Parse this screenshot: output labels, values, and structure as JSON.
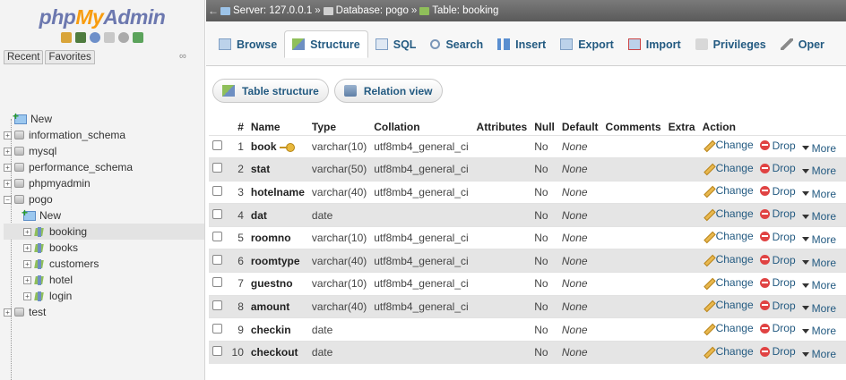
{
  "app": {
    "logo": {
      "php": "php",
      "my": "My",
      "admin": "Admin"
    }
  },
  "navigation": {
    "tabs": [
      "Recent",
      "Favorites"
    ],
    "new_label": "New",
    "databases": [
      "information_schema",
      "mysql",
      "performance_schema",
      "phpmyadmin",
      "pogo",
      "test"
    ],
    "pogo_children": [
      "New",
      "booking",
      "books",
      "customers",
      "hotel",
      "login"
    ],
    "selected_table": "booking"
  },
  "breadcrumb": {
    "server": "Server: 127.0.0.1",
    "database": "Database: pogo",
    "table": "Table: booking",
    "separator": "»"
  },
  "tabs": [
    "Browse",
    "Structure",
    "SQL",
    "Search",
    "Insert",
    "Export",
    "Import",
    "Privileges",
    "Oper"
  ],
  "active_tab": "Structure",
  "subtabs": [
    "Table structure",
    "Relation view"
  ],
  "table": {
    "headers": [
      "#",
      "Name",
      "Type",
      "Collation",
      "Attributes",
      "Null",
      "Default",
      "Comments",
      "Extra",
      "Action"
    ],
    "rows": [
      {
        "num": "1",
        "name": "book",
        "primary": true,
        "type": "varchar(10)",
        "collation": "utf8mb4_general_ci",
        "attributes": "",
        "null": "No",
        "default": "None",
        "comments": "",
        "extra": ""
      },
      {
        "num": "2",
        "name": "stat",
        "primary": false,
        "type": "varchar(50)",
        "collation": "utf8mb4_general_ci",
        "attributes": "",
        "null": "No",
        "default": "None",
        "comments": "",
        "extra": ""
      },
      {
        "num": "3",
        "name": "hotelname",
        "primary": false,
        "type": "varchar(40)",
        "collation": "utf8mb4_general_ci",
        "attributes": "",
        "null": "No",
        "default": "None",
        "comments": "",
        "extra": ""
      },
      {
        "num": "4",
        "name": "dat",
        "primary": false,
        "type": "date",
        "collation": "",
        "attributes": "",
        "null": "No",
        "default": "None",
        "comments": "",
        "extra": ""
      },
      {
        "num": "5",
        "name": "roomno",
        "primary": false,
        "type": "varchar(10)",
        "collation": "utf8mb4_general_ci",
        "attributes": "",
        "null": "No",
        "default": "None",
        "comments": "",
        "extra": ""
      },
      {
        "num": "6",
        "name": "roomtype",
        "primary": false,
        "type": "varchar(40)",
        "collation": "utf8mb4_general_ci",
        "attributes": "",
        "null": "No",
        "default": "None",
        "comments": "",
        "extra": ""
      },
      {
        "num": "7",
        "name": "guestno",
        "primary": false,
        "type": "varchar(10)",
        "collation": "utf8mb4_general_ci",
        "attributes": "",
        "null": "No",
        "default": "None",
        "comments": "",
        "extra": ""
      },
      {
        "num": "8",
        "name": "amount",
        "primary": false,
        "type": "varchar(40)",
        "collation": "utf8mb4_general_ci",
        "attributes": "",
        "null": "No",
        "default": "None",
        "comments": "",
        "extra": ""
      },
      {
        "num": "9",
        "name": "checkin",
        "primary": false,
        "type": "date",
        "collation": "",
        "attributes": "",
        "null": "No",
        "default": "None",
        "comments": "",
        "extra": ""
      },
      {
        "num": "10",
        "name": "checkout",
        "primary": false,
        "type": "date",
        "collation": "",
        "attributes": "",
        "null": "No",
        "default": "None",
        "comments": "",
        "extra": ""
      }
    ],
    "actions": {
      "change": "Change",
      "drop": "Drop",
      "more": "More"
    }
  },
  "colors": {
    "link": "#235a81",
    "row_alt": "#e5e5e5",
    "header_bar": "#666666"
  }
}
